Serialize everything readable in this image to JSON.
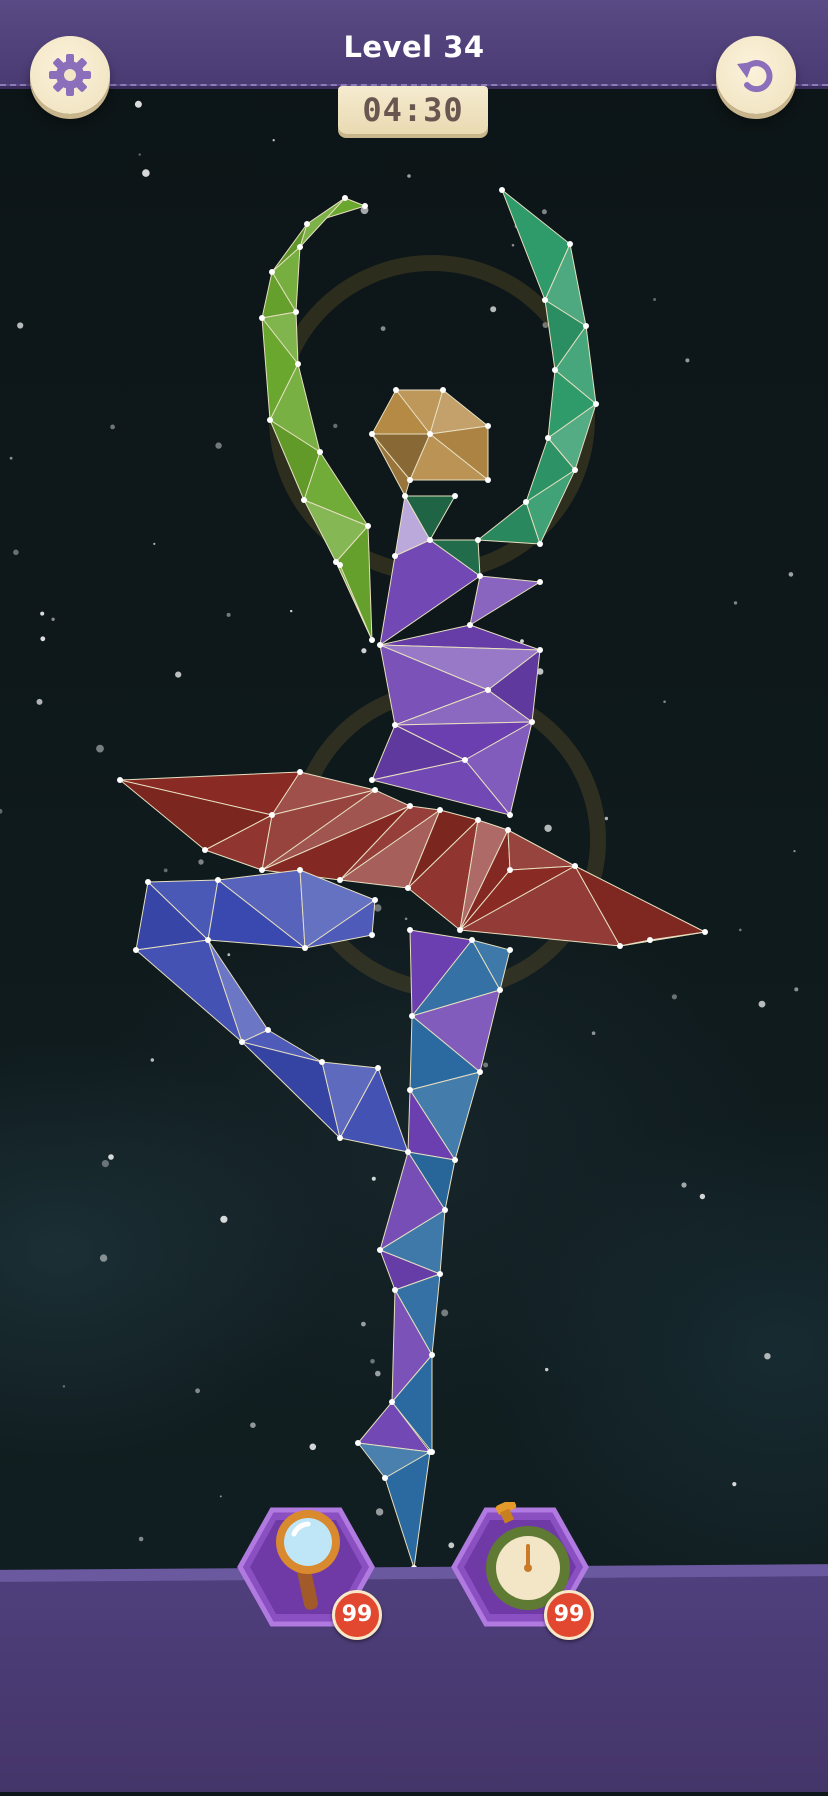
{
  "header": {
    "level_title": "Level 34",
    "timer": "04:30",
    "settings_icon": "gear-icon",
    "restart_icon": "restart-icon"
  },
  "boosters": [
    {
      "name": "hint",
      "icon": "magnifier-icon",
      "count": "99"
    },
    {
      "name": "add-time",
      "icon": "stopwatch-icon",
      "count": "99"
    }
  ],
  "puzzle": {
    "subject": "ballerina",
    "colors": {
      "arms_left": "#6aa72e",
      "arms_right": "#2f9a6a",
      "head": "#b58a45",
      "torso": "#6b3fb0",
      "tutu": "#8a2a24",
      "leg_back": "#3a49b0",
      "leg_front": "#2a6aa0"
    }
  },
  "theme": {
    "bar_purple": "#4a3b73",
    "button_cream": "#f3e6c6",
    "badge_red": "#e2472f",
    "icon_purple": "#8b6fba"
  }
}
